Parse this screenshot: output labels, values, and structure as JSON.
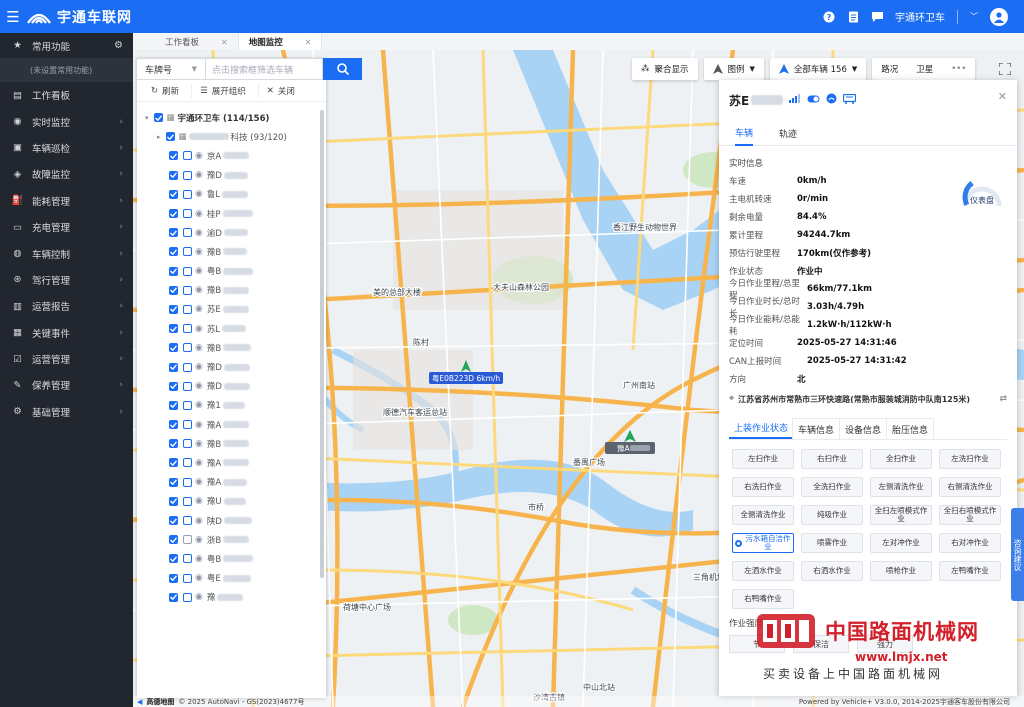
{
  "topbar": {
    "brand": "宇通车联网",
    "user": "宇通环卫车"
  },
  "sidebar": {
    "favorites_label": "常用功能",
    "favorites_note": "(未设置常用功能)",
    "items": [
      {
        "label": "工作看板",
        "icon": "dashboard-icon",
        "arrow": false
      },
      {
        "label": "实时监控",
        "icon": "monitor-icon",
        "arrow": true
      },
      {
        "label": "车辆巡检",
        "icon": "bus-icon",
        "arrow": true
      },
      {
        "label": "故障监控",
        "icon": "car-fault-icon",
        "arrow": true
      },
      {
        "label": "能耗管理",
        "icon": "fuel-icon",
        "arrow": true
      },
      {
        "label": "充电管理",
        "icon": "charging-icon",
        "arrow": true
      },
      {
        "label": "车辆控制",
        "icon": "steering-icon",
        "arrow": true
      },
      {
        "label": "驾行管理",
        "icon": "wheel-icon",
        "arrow": true
      },
      {
        "label": "运营报告",
        "icon": "report-icon",
        "arrow": true
      },
      {
        "label": "关键事件",
        "icon": "event-icon",
        "arrow": true
      },
      {
        "label": "运营管理",
        "icon": "operation-icon",
        "arrow": true
      },
      {
        "label": "保养管理",
        "icon": "maintenance-icon",
        "arrow": true
      },
      {
        "label": "基础管理",
        "icon": "gear-icon",
        "arrow": true
      }
    ]
  },
  "tabs": [
    {
      "label": "工作看板"
    },
    {
      "label": "地图监控"
    }
  ],
  "vehicle_panel": {
    "search_type": "车牌号",
    "search_placeholder": "点击搜索框筛选车辆",
    "actions": [
      "刷新",
      "展开组织",
      "关闭"
    ],
    "root": "宇通环卫车 (114/156)",
    "group_suffix": "科技 (93/120)",
    "vehicles": [
      {
        "prefix": "京A",
        "w": 26,
        "on": true
      },
      {
        "prefix": "豫D",
        "w": 24,
        "on": true
      },
      {
        "prefix": "鲁L",
        "w": 26,
        "on": true
      },
      {
        "prefix": "桂P",
        "w": 30,
        "on": true
      },
      {
        "prefix": "渝D",
        "w": 24,
        "on": true
      },
      {
        "prefix": "豫B",
        "w": 24,
        "on": true
      },
      {
        "prefix": "粤B",
        "w": 30,
        "on": true
      },
      {
        "prefix": "豫B",
        "w": 26,
        "on": true
      },
      {
        "prefix": "苏E",
        "w": 26,
        "on": true
      },
      {
        "prefix": "苏L",
        "w": 24,
        "on": true
      },
      {
        "prefix": "豫B",
        "w": 28,
        "on": true
      },
      {
        "prefix": "豫D",
        "w": 26,
        "on": true
      },
      {
        "prefix": "豫D",
        "w": 26,
        "on": true
      },
      {
        "prefix": "豫1",
        "w": 22,
        "on": true
      },
      {
        "prefix": "豫A",
        "w": 26,
        "on": true
      },
      {
        "prefix": "豫B",
        "w": 26,
        "on": true
      },
      {
        "prefix": "豫A",
        "w": 26,
        "on": true
      },
      {
        "prefix": "豫A",
        "w": 24,
        "on": true
      },
      {
        "prefix": "豫U",
        "w": 22,
        "on": true
      },
      {
        "prefix": "陕D",
        "w": 28,
        "on": true
      },
      {
        "prefix": "浙B",
        "w": 26,
        "on": false
      },
      {
        "prefix": "粤B",
        "w": 30,
        "on": true
      },
      {
        "prefix": "粤E",
        "w": 28,
        "on": true
      },
      {
        "prefix": "豫",
        "w": 26,
        "on": true
      }
    ]
  },
  "map_toolbar": {
    "cluster": "聚合显示",
    "legend": "图例",
    "all_vehicles": "全部车辆 156",
    "traffic": "路况",
    "satellite": "卫星"
  },
  "map_labels": [
    {
      "text": "佛山",
      "size": 12
    },
    {
      "text": "大夫山森林公园",
      "size": 8
    },
    {
      "text": "美的总部大楼",
      "size": 8
    },
    {
      "text": "顺德汽车客运总站",
      "size": 8
    },
    {
      "text": "三洪奇大桥",
      "size": 8
    },
    {
      "text": "香江野生动物世界",
      "size": 8
    },
    {
      "text": "荷塘中心广场",
      "size": 8
    },
    {
      "text": "广州南站",
      "size": 8
    },
    {
      "text": "番禺广场",
      "size": 8
    },
    {
      "text": "沙湾古镇",
      "size": 8
    },
    {
      "text": "容桂",
      "size": 8
    },
    {
      "text": "中山北站",
      "size": 8
    },
    {
      "text": "高铁站",
      "size": 8
    },
    {
      "text": "三角机场",
      "size": 8
    },
    {
      "text": "市桥",
      "size": 8
    },
    {
      "text": "陈村",
      "size": 8
    },
    {
      "text": "伦教",
      "size": 8
    }
  ],
  "map_markers": {
    "marker1": "粤E0B223D 6km/h",
    "marker2": "豫A"
  },
  "detail": {
    "plate": "苏E",
    "tabs": [
      "车辆",
      "轨迹"
    ],
    "realtime_title": "实时信息",
    "gauge_label": "仪表盘",
    "gauge_value": 0.35,
    "fields": [
      {
        "k": "车速",
        "v": "0km/h"
      },
      {
        "k": "主电机转速",
        "v": "0r/min"
      },
      {
        "k": "剩余电量",
        "v": "84.4%"
      },
      {
        "k": "累计里程",
        "v": "94244.7km"
      },
      {
        "k": "预估行驶里程",
        "v": "170km(仅作参考)"
      },
      {
        "k": "作业状态",
        "v": "作业中"
      },
      {
        "k": "今日作业里程/总里程",
        "v": "66km/77.1km"
      },
      {
        "k": "今日作业时长/总时长",
        "v": "3.03h/4.79h"
      },
      {
        "k": "今日作业能耗/总能耗",
        "v": "1.2kW·h/112kW·h"
      },
      {
        "k": "定位时间",
        "v": "2025-05-27 14:31:46"
      },
      {
        "k": "CAN上报时间",
        "v": "2025-05-27 14:31:42"
      },
      {
        "k": "方向",
        "v": "北"
      }
    ],
    "address": "江苏省苏州市常熟市三环快速路(常熟市服装城消防中队南125米)",
    "sub_tabs": [
      "上装作业状态",
      "车辆信息",
      "设备信息",
      "胎压信息"
    ],
    "operations": [
      "左扫作业",
      "右扫作业",
      "全扫作业",
      "左洗扫作业",
      "右洗扫作业",
      "全洗扫作业",
      "左侧清洗作业",
      "右侧清洗作业",
      "全侧清洗作业",
      "纯吸作业",
      "全扫左喷模式作业",
      "全扫右喷模式作业",
      "污水箱自洁作业",
      "喷雾作业",
      "左对冲作业",
      "右对冲作业",
      "左洒水作业",
      "右洒水作业",
      "喷枪作业",
      "左鸭嘴作业",
      "右鸭嘴作业"
    ],
    "selected_op": "污水箱自洁作业",
    "intensity_label": "作业强度",
    "intensity": [
      "节",
      "保洁",
      "强力"
    ]
  },
  "consult": "咨询建议",
  "watermark": {
    "brand": "中国路面机械网",
    "site": "www.lmjx.net",
    "slogan": "买卖设备上中国路面机械网"
  },
  "copyright": {
    "amap": "高德地图",
    "text": "© 2025 AutoNavi - GS(2023)4677号",
    "powered": "Powered by Vehicle+ V3.0.0, 2014-2025宇通客车股份有限公司"
  }
}
